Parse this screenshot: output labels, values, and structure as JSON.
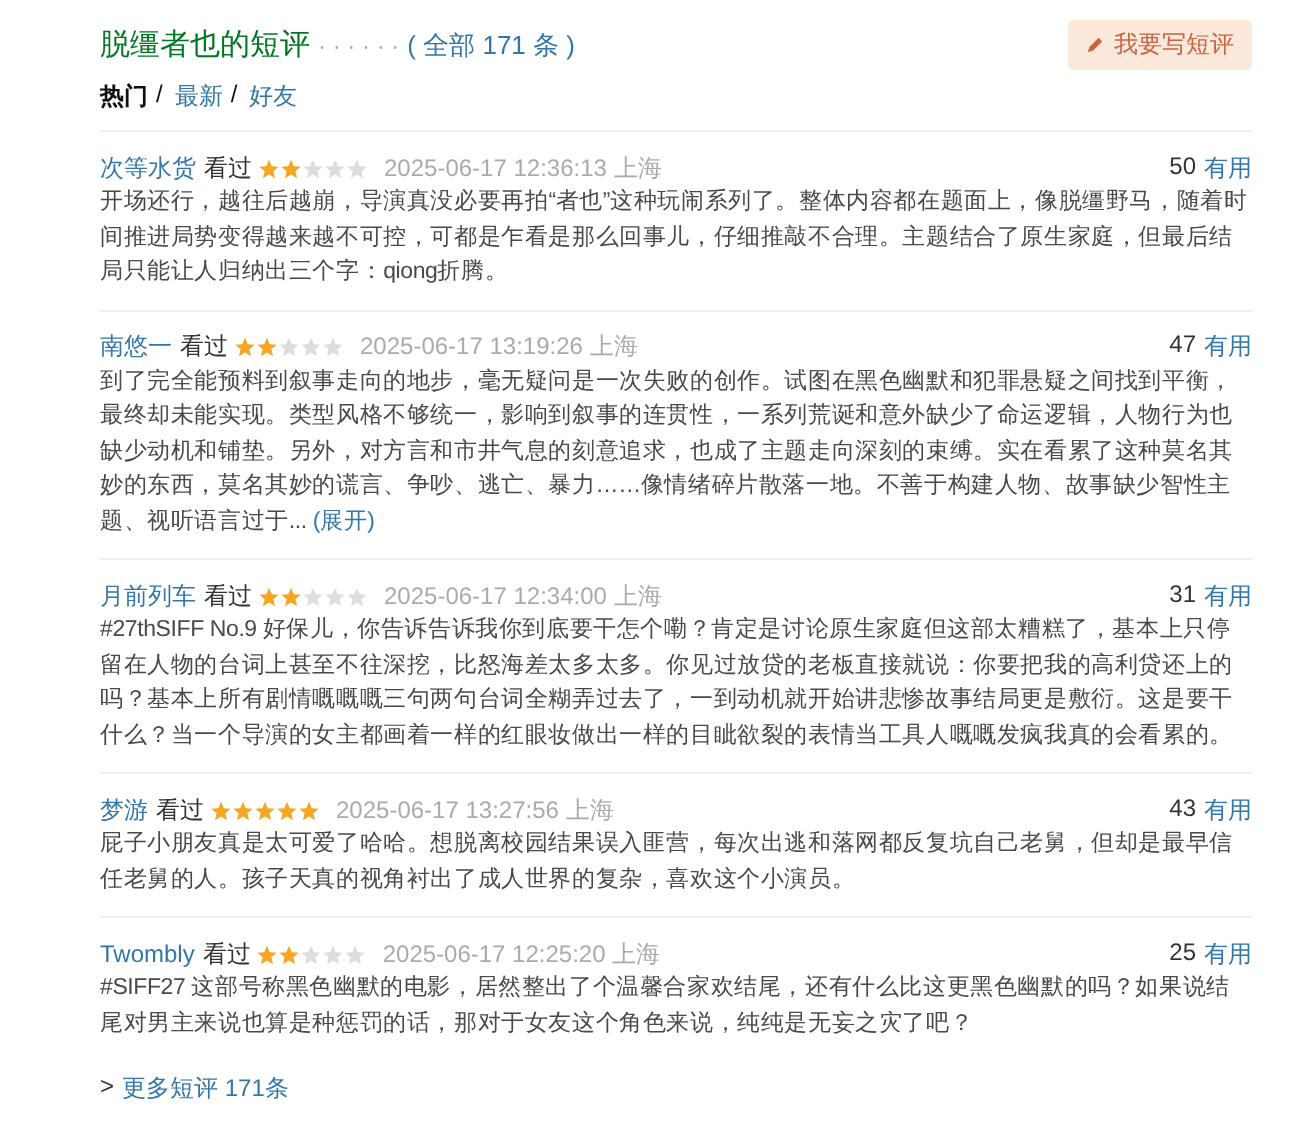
{
  "header": {
    "title": "脱缰者也的短评",
    "dots": "· · · · · ·",
    "total": "( 全部 171 条 )",
    "write_button": "我要写短评"
  },
  "tabs": [
    {
      "label": "热门",
      "selected": true,
      "separator": "/"
    },
    {
      "label": "最新",
      "selected": false,
      "separator": "/"
    },
    {
      "label": "好友",
      "selected": false
    }
  ],
  "reviews": [
    {
      "user": "次等水货",
      "status": "看过",
      "stars": 2,
      "time": "2025-06-17 12:36:13 上海",
      "votes": "50",
      "votes_label": "有用",
      "text": "开场还行，越往后越崩，导演真没必要再拍“者也”这种玩闹系列了。整体内容都在题面上，像脱缰野马，随着时间推进局势变得越来越不可控，可都是乍看是那么回事儿，仔细推敲不合理。主题结合了原生家庭，但最后结局只能让人归纳出三个字：qiong折腾。"
    },
    {
      "user": "南悠一",
      "status": "看过",
      "stars": 2,
      "time": "2025-06-17 13:19:26 上海",
      "votes": "47",
      "votes_label": "有用",
      "text": "到了完全能预料到叙事走向的地步，毫无疑问是一次失败的创作。试图在黑色幽默和犯罪悬疑之间找到平衡，最终却未能实现。类型风格不够统一，影响到叙事的连贯性，一系列荒诞和意外缺少了命运逻辑，人物行为也缺少动机和铺垫。另外，对方言和市井气息的刻意追求，也成了主题走向深刻的束缚。实在看累了这种莫名其妙的东西，莫名其妙的谎言、争吵、逃亡、暴力……像情绪碎片散落一地。不善于构建人物、故事缺少智性主题、视听语言过于...",
      "expand": "(展开)"
    },
    {
      "user": "月前列车",
      "status": "看过",
      "stars": 2,
      "time": "2025-06-17 12:34:00 上海",
      "votes": "31",
      "votes_label": "有用",
      "text": "#27thSIFF No.9 好保儿，你告诉告诉我你到底要干怎个嘞？肯定是讨论原生家庭但这部太糟糕了，基本上只停留在人物的台词上甚至不往深挖，比怒海差太多太多。你见过放贷的老板直接就说：你要把我的高利贷还上的吗？基本上所有剧情嘅嘅嘅三句两句台词全糊弄过去了，一到动机就开始讲悲惨故事结局更是敷衍。这是要干什么？当一个导演的女主都画着一样的红眼妆做出一样的目眦欲裂的表情当工具人嘅嘅发疯我真的会看累的。"
    },
    {
      "user": "梦游",
      "status": "看过",
      "stars": 5,
      "time": "2025-06-17 13:27:56 上海",
      "votes": "43",
      "votes_label": "有用",
      "text": "屁子小朋友真是太可爱了哈哈。想脱离校园结果误入匪营，每次出逃和落网都反复坑自己老舅，但却是最早信任老舅的人。孩子天真的视角衬出了成人世界的复杂，喜欢这个小演员。"
    },
    {
      "user": "Twombly",
      "status": "看过",
      "stars": 2,
      "time": "2025-06-17 12:25:20 上海",
      "votes": "25",
      "votes_label": "有用",
      "text": "#SIFF27 这部号称黑色幽默的电影，居然整出了个温馨合家欢结尾，还有什么比这更黑色幽默的吗？如果说结尾对男主来说也算是种惩罚的话，那对于女友这个角色来说，纯纯是无妄之灾了吧？"
    }
  ],
  "more": {
    "arrow": ">",
    "label": "更多短评 171条"
  }
}
